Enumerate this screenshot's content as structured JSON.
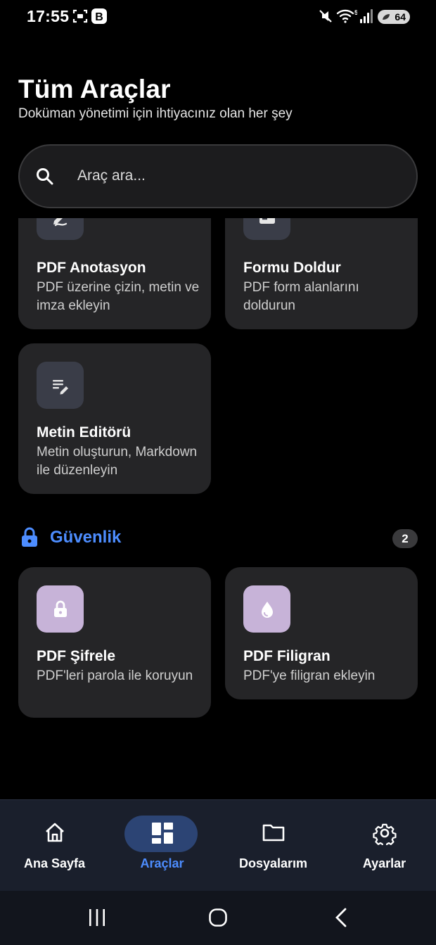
{
  "status_bar": {
    "time": "17:55",
    "left_icons": [
      "screenshot-icon",
      "b-notification-icon"
    ],
    "right_icons": [
      "mute-icon",
      "wifi-icon",
      "signal-icon"
    ],
    "battery": "64"
  },
  "header": {
    "title": "Tüm Araçlar",
    "subtitle": "Doküman yönetimi için ihtiyacınız olan her şey"
  },
  "search": {
    "placeholder": "Araç ara..."
  },
  "tools_partial": [
    {
      "title": "PDF Anotasyon",
      "desc": "PDF üzerine çizin, metin ve imza ekleyin",
      "icon": "draw-icon"
    },
    {
      "title": "Formu Doldur",
      "desc": "PDF form alanlarını doldurun",
      "icon": "form-check-icon"
    },
    {
      "title": "Metin Editörü",
      "desc": "Metin oluşturun, Markdown ile düzenleyin",
      "icon": "text-edit-icon"
    }
  ],
  "security_section": {
    "title": "Güvenlik",
    "count": "2",
    "icon": "lock-icon",
    "tools": [
      {
        "title": "PDF Şifrele",
        "desc": "PDF'leri parola ile koruyun",
        "icon": "lock-icon"
      },
      {
        "title": "PDF Filigran",
        "desc": "PDF'ye filigran ekleyin",
        "icon": "droplet-icon"
      }
    ]
  },
  "bottom_nav": {
    "items": [
      {
        "label": "Ana Sayfa",
        "icon": "home-icon",
        "active": false
      },
      {
        "label": "Araçlar",
        "icon": "dashboard-icon",
        "active": true
      },
      {
        "label": "Dosyalarım",
        "icon": "folder-icon",
        "active": false
      },
      {
        "label": "Ayarlar",
        "icon": "gear-icon",
        "active": false
      }
    ]
  },
  "colors": {
    "accent": "#4d8dff",
    "card_bg": "#252527",
    "icon_bg": "#3a3d48",
    "security_icon_bg": "#c7b3d8",
    "nav_bg": "#1a1f2c",
    "nav_pill": "#2c4474"
  }
}
